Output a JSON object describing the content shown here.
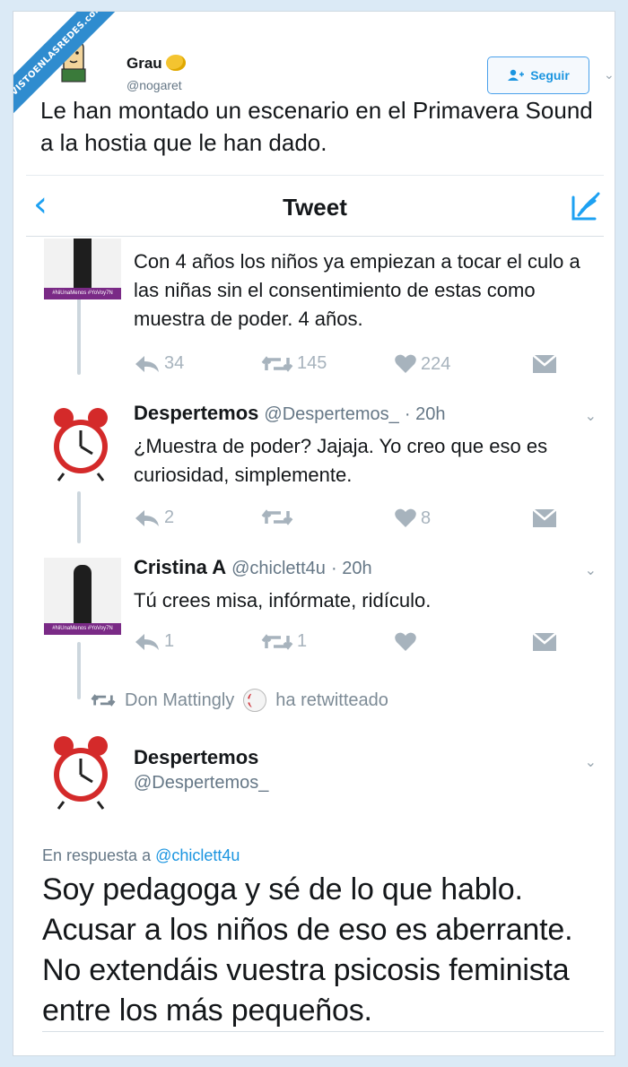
{
  "watermark": "VISTOENLASREDES.com",
  "outer_tweet": {
    "name": "Grau",
    "handle": "@nogaret",
    "follow_label": "Seguir",
    "text": "Le han montado un escenario en el Primavera Sound a la hostia que le han dado."
  },
  "inner": {
    "title": "Tweet",
    "tweets": [
      {
        "text": "Con 4 años los niños ya empiezan a tocar el culo a las niñas sin el consentimiento de estas como muestra de poder. 4 años.",
        "replies": "34",
        "retweets": "145",
        "likes": "224",
        "avatar_tag": "#NiUnaMenos #YoVoy7N"
      },
      {
        "name": "Despertemos",
        "handle": "@Despertemos_",
        "time": "· 20h",
        "text": "¿Muestra de poder? Jajaja. Yo creo que eso es curiosidad, simplemente.",
        "replies": "2",
        "retweets": "",
        "likes": "8"
      },
      {
        "name": "Cristina A",
        "handle": "@chiclett4u",
        "time": "· 20h",
        "text": "Tú crees misa, infórmate, ridículo.",
        "replies": "1",
        "retweets": "1",
        "likes": "",
        "avatar_tag": "#NiUnaMenos #YoVoy7N"
      }
    ],
    "retweeted_by": "Don Mattingly",
    "retweeted_suffix": "ha retwitteado",
    "main": {
      "name": "Despertemos",
      "handle": "@Despertemos_",
      "reply_prefix": "En respuesta a",
      "reply_mention": "@chiclett4u",
      "text_lines": [
        "Soy pedagoga y sé de lo que hablo.",
        "Acusar a los niños de eso es aberrante.",
        "No extendáis vuestra psicosis feminista",
        "entre los más pequeños."
      ]
    }
  },
  "colors": {
    "twitter_blue": "#1da1f2",
    "muted": "#657786",
    "action_gray": "#a7b3bd",
    "background": "#dbeaf6"
  },
  "icons": [
    "reply-icon",
    "retweet-icon",
    "heart-icon",
    "direct-message-icon",
    "compose-icon",
    "back-chevron-icon",
    "alarm-clock-icon"
  ]
}
